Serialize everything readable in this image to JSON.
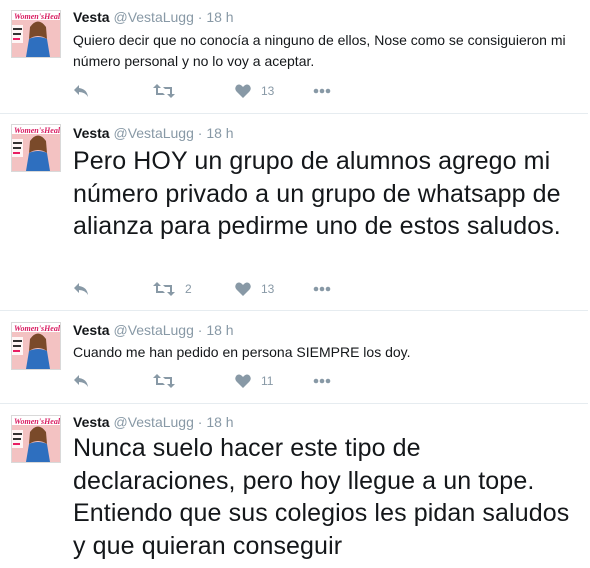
{
  "tweets": [
    {
      "name": "Vesta",
      "handle": "@VestaLugg",
      "time": "18 h",
      "text": "Quiero decir que no conocía a ninguno de ellos, Nose como se consiguieron mi número personal y no lo voy a aceptar.",
      "retweets": "",
      "likes": "13"
    },
    {
      "name": "Vesta",
      "handle": "@VestaLugg",
      "time": "18 h",
      "text": "Pero HOY un grupo de alumnos agrego mi número privado a un grupo de whatsapp de alianza para pedirme uno de estos saludos.",
      "retweets": "2",
      "likes": "13"
    },
    {
      "name": "Vesta",
      "handle": "@VestaLugg",
      "time": "18 h",
      "text": "Cuando me han pedido en persona SIEMPRE los doy.",
      "retweets": "",
      "likes": "11"
    },
    {
      "name": "Vesta",
      "handle": "@VestaLugg",
      "time": "18 h",
      "text": "Nunca suelo hacer este tipo de declaraciones, pero hoy llegue a un tope. Entiendo que sus colegios les pidan saludos y que quieran conseguir",
      "retweets": "",
      "likes": ""
    }
  ],
  "avatar_brand": "Women'sHealth",
  "icons": [
    "reply-icon",
    "retweet-icon",
    "heart-icon",
    "more-icon"
  ],
  "colors": {
    "text": "#14171a",
    "muted": "#8899a6",
    "divider": "#e6ecf0"
  }
}
